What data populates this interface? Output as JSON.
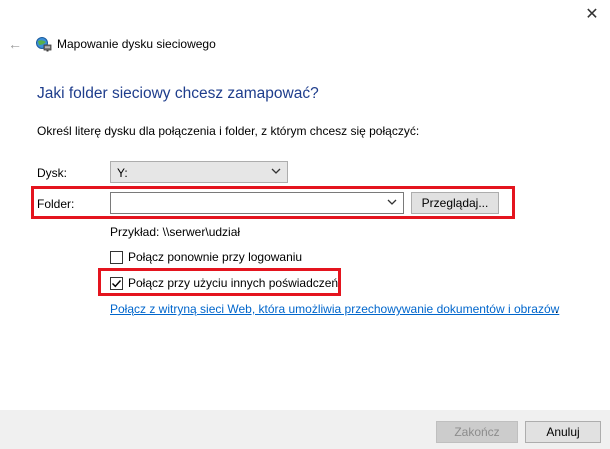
{
  "window": {
    "close_glyph": "✕",
    "back_glyph": "←",
    "title": "Mapowanie dysku sieciowego"
  },
  "heading": "Jaki folder sieciowy chcesz zamapować?",
  "instruction": "Określ literę dysku dla połączenia i folder, z którym chcesz się połączyć:",
  "drive": {
    "label": "Dysk:",
    "value": "Y:"
  },
  "folder": {
    "label": "Folder:",
    "value": "",
    "browse_label": "Przeglądaj..."
  },
  "example": "Przykład: \\\\serwer\\udział",
  "options": {
    "reconnect": {
      "label": "Połącz ponownie przy logowaniu",
      "checked": false
    },
    "other_credentials": {
      "label": "Połącz przy użyciu innych poświadczeń",
      "checked": true
    }
  },
  "web_link": "Połącz z witryną sieci Web, która umożliwia przechowywanie dokumentów i obrazów",
  "web_link_suffix": ".",
  "footer": {
    "finish_label": "Zakończ",
    "cancel_label": "Anuluj"
  },
  "colors": {
    "heading": "#1e3d8c",
    "highlight": "#e4141e",
    "link": "#0066cc"
  },
  "icons": [
    "close-icon",
    "back-arrow-icon",
    "network-drive-icon",
    "chevron-down-icon",
    "checkmark-icon"
  ]
}
